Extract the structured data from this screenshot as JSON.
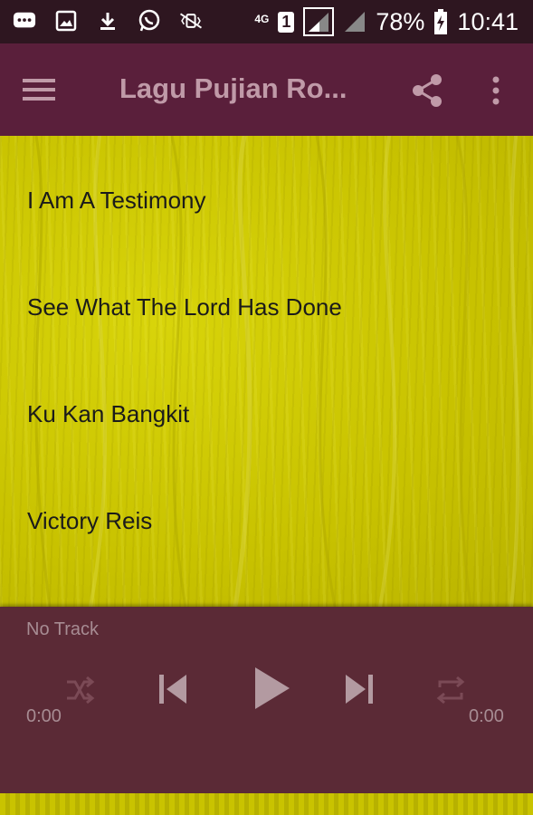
{
  "status_bar": {
    "network_label": "4G",
    "sim_label": "1",
    "battery_percent": "78%",
    "time": "10:41"
  },
  "app_bar": {
    "title": "Lagu Pujian Ro..."
  },
  "songs": [
    {
      "title": "I Am A Testimony"
    },
    {
      "title": "See What The Lord Has Done"
    },
    {
      "title": "Ku Kan Bangkit"
    },
    {
      "title": "Victory Reis"
    }
  ],
  "player": {
    "track_label": "No Track",
    "elapsed": "0:00",
    "duration": "0:00"
  },
  "colors": {
    "app_bar": "#5a1f3b",
    "player": "#5b2a36",
    "content_background": "#c8c200"
  }
}
